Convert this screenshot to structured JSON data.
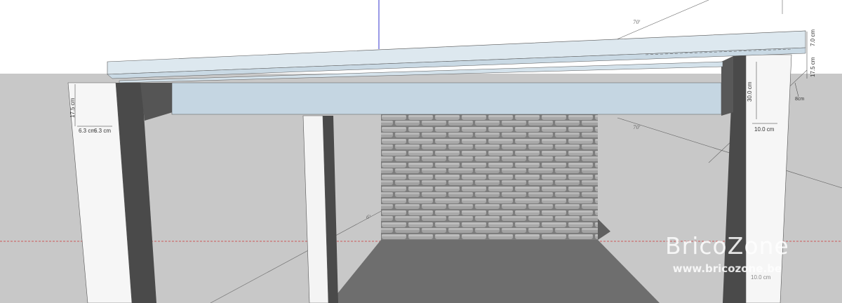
{
  "viewport": {
    "label": "3D model viewport",
    "sky_color": "#ffffff",
    "ground_color": "#c8c8c8"
  },
  "dimensions": {
    "beam_height": "7.0 cm",
    "front_beam_height": "17.5 cm",
    "post_left_height": "17.5 cm",
    "post_left_width_a": "6.3 cm",
    "post_left_width_b": "6.3 cm",
    "post_right_height": "30.0 cm",
    "post_right_width": "10.0 cm",
    "small_right": "8cm",
    "bottom_right": "10.0 cm"
  },
  "axis_labels": {
    "top": "70'",
    "mid": "70'",
    "low": "6'"
  },
  "watermark": {
    "brand": "BricoZone",
    "url": "www.bricozone.be"
  },
  "colors": {
    "roof_face": "#dde8ef",
    "roof_fascia": "#c5d6e2",
    "post_white": "#f6f6f6",
    "post_shadow": "#4a4a4a",
    "brick_wall": "#8a8a8a",
    "floor_shadow": "#6e6e6e"
  }
}
